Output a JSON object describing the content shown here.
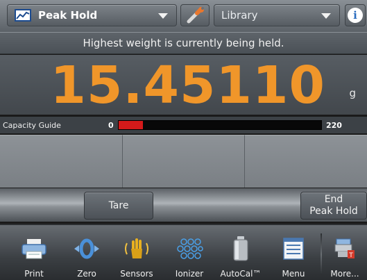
{
  "topbar": {
    "application_label": "Peak Hold",
    "library_label": "Library",
    "info_label": "i"
  },
  "status_message": "Highest weight is currently being held.",
  "weight": {
    "value": "15.45110",
    "unit": "g"
  },
  "capacity_guide": {
    "label": "Capacity Guide",
    "min": "0",
    "max": "220",
    "fill_fraction": 0.12,
    "fill_color": "#d41a1a"
  },
  "actions": {
    "tare_label": "Tare",
    "end_peak_hold_line1": "End",
    "end_peak_hold_line2": "Peak Hold"
  },
  "menu": {
    "items": [
      {
        "label": "Print",
        "icon": "printer-icon"
      },
      {
        "label": "Zero",
        "icon": "zero-icon"
      },
      {
        "label": "Sensors",
        "icon": "hand-sensor-icon"
      },
      {
        "label": "Ionizer",
        "icon": "ionizer-icon"
      },
      {
        "label": "AutoCal™",
        "icon": "weight-icon"
      },
      {
        "label": "Menu",
        "icon": "menu-list-icon"
      },
      {
        "label": "More...",
        "icon": "more-icon"
      }
    ]
  },
  "colors": {
    "weight_digits": "#f0962a",
    "accent_blue": "#2a6cbf"
  }
}
